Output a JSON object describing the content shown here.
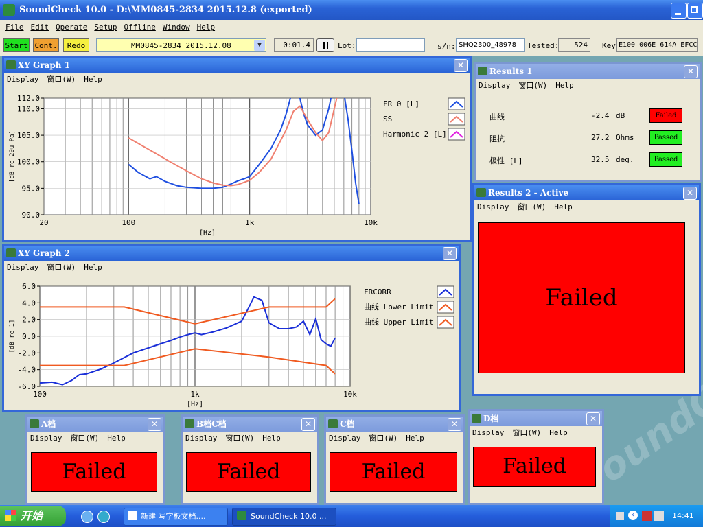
{
  "app": {
    "title": "SoundCheck 10.0 - D:\\MM0845-2834 2015.12.8 (exported)",
    "menu": [
      "File",
      "Edit",
      "Operate",
      "Setup",
      "Offline",
      "Window",
      "Help"
    ],
    "buttons": {
      "start": "Start",
      "cont": "Cont.",
      "redo": "Redo"
    },
    "sequence": "MM0845-2834 2015.12.08",
    "time": "0:01.4",
    "pause_icon": "pause-icon",
    "lot_label": "Lot:",
    "lot_value": "",
    "sn_label": "s/n:",
    "sn_value": "SHQ2300_48978",
    "tested_label": "Tested:",
    "tested_value": "524",
    "key_label": "Key",
    "key_value": "E100 006E 614A EFCC"
  },
  "submenu": {
    "display": "Display",
    "window": "窗口(W)",
    "help": "Help"
  },
  "xy1": {
    "title": "XY Graph 1",
    "chart_data": {
      "type": "line",
      "xscale": "log",
      "xlim": [
        20,
        10000
      ],
      "ylim": [
        90,
        112
      ],
      "xlabel": "[Hz]",
      "ylabel": "[dB re 20u Pa]",
      "yticks": [
        "112.0",
        "110.0",
        "105.0",
        "100.0",
        "95.0",
        "90.0"
      ],
      "xticks": [
        "20",
        "100",
        "1k",
        "10k"
      ],
      "grid": true,
      "legend_position": "right",
      "series": [
        {
          "name": "FR_0 [L]",
          "color": "#1f4fe0",
          "x": [
            100,
            120,
            150,
            170,
            200,
            250,
            300,
            400,
            500,
            600,
            700,
            800,
            900,
            1000,
            1200,
            1500,
            1800,
            2000,
            2200,
            2400,
            2600,
            2800,
            3000,
            3500,
            4000,
            4500,
            5000,
            5200,
            5500,
            6000,
            6500,
            7000,
            7500,
            8000
          ],
          "y": [
            99.5,
            98.0,
            96.8,
            97.2,
            96.3,
            95.5,
            95.2,
            95.0,
            95.0,
            95.2,
            95.8,
            96.4,
            96.8,
            97.2,
            99.5,
            102.5,
            106.0,
            109.0,
            112.5,
            114.0,
            112.0,
            109.0,
            107.0,
            105.0,
            106.0,
            110.0,
            115.0,
            113.0,
            115.0,
            113.0,
            108.0,
            102.0,
            96.0,
            92.0
          ]
        },
        {
          "name": "SS",
          "color": "#f08070",
          "x": [
            100,
            130,
            170,
            220,
            300,
            400,
            500,
            600,
            700,
            800,
            1000,
            1200,
            1500,
            2000,
            2300,
            2600,
            3000,
            3500,
            4000,
            4500,
            5000,
            5500,
            6000
          ],
          "y": [
            104.5,
            103.0,
            101.5,
            100.0,
            98.3,
            96.8,
            96.0,
            95.6,
            95.5,
            95.7,
            96.5,
            98.0,
            100.5,
            106.0,
            109.5,
            110.5,
            108.0,
            105.5,
            104.0,
            105.5,
            110.0,
            114.0,
            116.0
          ]
        }
      ],
      "legend": [
        "FR_0 [L]",
        "SS",
        "Harmonic 2 [L]"
      ]
    }
  },
  "xy2": {
    "title": "XY Graph 2",
    "chart_data": {
      "type": "line",
      "xscale": "log",
      "xlim": [
        100,
        10000
      ],
      "ylim": [
        -6,
        6
      ],
      "xlabel": "[Hz]",
      "ylabel": "[dB re 1]",
      "yticks": [
        "6.0",
        "4.0",
        "2.0",
        "0.0",
        "-2.0",
        "-4.0",
        "-6.0"
      ],
      "xticks": [
        "100",
        "1k",
        "10k"
      ],
      "grid": true,
      "legend_position": "right",
      "series": [
        {
          "name": "FRCORR",
          "color": "#1a2fd8",
          "x": [
            100,
            120,
            140,
            160,
            180,
            200,
            250,
            300,
            400,
            500,
            600,
            700,
            800,
            900,
            1000,
            1100,
            1300,
            1600,
            2000,
            2200,
            2400,
            2700,
            3000,
            3500,
            4000,
            4500,
            5000,
            5500,
            6000,
            6500,
            7000,
            7500,
            8000
          ],
          "y": [
            -5.6,
            -5.5,
            -5.8,
            -5.3,
            -4.6,
            -4.5,
            -3.9,
            -3.2,
            -2.0,
            -1.4,
            -0.9,
            -0.5,
            -0.1,
            0.2,
            0.4,
            0.2,
            0.5,
            1.0,
            1.8,
            3.3,
            4.7,
            4.3,
            1.6,
            0.9,
            0.9,
            1.1,
            1.8,
            0.2,
            2.1,
            -0.4,
            -0.9,
            -1.2,
            -0.2
          ]
        },
        {
          "name": "曲线 Lower Limit",
          "color": "#f05a20",
          "x": [
            100,
            350,
            1000,
            3000,
            7000,
            8000
          ],
          "y": [
            -3.5,
            -3.5,
            -1.5,
            -2.5,
            -3.5,
            -4.5
          ]
        },
        {
          "name": "曲线 Upper Limit",
          "color": "#f05a20",
          "x": [
            100,
            350,
            1000,
            3000,
            7000,
            8000
          ],
          "y": [
            3.5,
            3.5,
            1.5,
            3.5,
            3.5,
            4.5
          ]
        }
      ],
      "legend": [
        "FRCORR",
        "曲线 Lower Limit",
        "曲线 Upper Limit"
      ]
    }
  },
  "results1": {
    "title": "Results 1",
    "rows": [
      {
        "name": "曲线",
        "value": "-2.4",
        "unit": "dB",
        "status": "Failed",
        "color": "#ff0000"
      },
      {
        "name": "阻抗",
        "value": "27.2",
        "unit": "Ohms",
        "status": "Passed",
        "color": "#22ee22"
      },
      {
        "name": "极性 [L]",
        "value": "32.5",
        "unit": "deg.",
        "status": "Passed",
        "color": "#22ee22"
      }
    ]
  },
  "results2": {
    "title": "Results 2 - Active",
    "status": "Failed"
  },
  "bins": [
    {
      "title": "A档",
      "status": "Failed"
    },
    {
      "title": "B档C档",
      "status": "Failed"
    },
    {
      "title": "C档",
      "status": "Failed"
    },
    {
      "title": "D档",
      "status": "Failed"
    }
  ],
  "taskbar": {
    "start": "开始",
    "items": [
      "新建 写字板文档....",
      "SoundCheck 10.0 ..."
    ],
    "clock": "14:41"
  }
}
